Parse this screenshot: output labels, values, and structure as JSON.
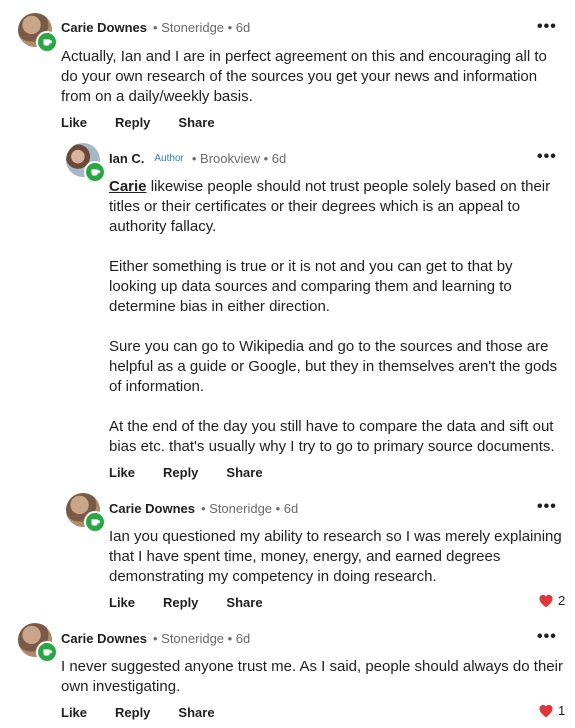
{
  "comments": [
    {
      "author": "Carie Downes",
      "meta": "• Stoneridge • 6d",
      "more": "•••",
      "paragraphs": [
        "Actually, Ian and I are in perfect agreement on this and encouraging all to do your own research of the sources you get your news and information from on a daily/weekly basis."
      ],
      "actions": {
        "like": "Like",
        "reply": "Reply",
        "share": "Share"
      }
    },
    {
      "author": "Ian C.",
      "author_tag": "Author",
      "meta": "• Brookview • 6d",
      "more": "•••",
      "mention": "Carie",
      "first_paragraph_rest": " likewise people should not trust people solely based on their titles or their certificates or their degrees which is an appeal to authority fallacy.",
      "paragraphs": [
        "Either something is true or it is not and you can get to that by looking up data sources and comparing them and learning to determine bias in either direction.",
        "Sure you can go to Wikipedia and go to the sources and those are helpful as a guide or Google, but they in themselves aren't the gods of information.",
        "At the end of the day you still have to compare the data and sift out bias etc. that's usually why I try to go to primary source documents."
      ],
      "actions": {
        "like": "Like",
        "reply": "Reply",
        "share": "Share"
      }
    },
    {
      "author": "Carie Downes",
      "meta": "• Stoneridge • 6d",
      "more": "•••",
      "paragraphs": [
        "Ian you questioned my ability to research so I was merely explaining that I have spent time, money, energy, and earned degrees demonstrating my competency in doing research."
      ],
      "actions": {
        "like": "Like",
        "reply": "Reply",
        "share": "Share"
      },
      "reaction_count": "2"
    },
    {
      "author": "Carie Downes",
      "meta": "• Stoneridge • 6d",
      "more": "•••",
      "paragraphs": [
        "I never suggested anyone trust me.  As I said, people should always do their own investigating."
      ],
      "actions": {
        "like": "Like",
        "reply": "Reply",
        "share": "Share"
      },
      "reaction_count": "1"
    }
  ],
  "icons": {
    "badge": "coffee-cup-icon",
    "reaction": "heart-icon",
    "more": "more-options-icon"
  },
  "colors": {
    "badge": "#28a745",
    "author_tag": "#2b7fb3",
    "heart": "#e0353b",
    "meta": "#6b6b6b"
  }
}
